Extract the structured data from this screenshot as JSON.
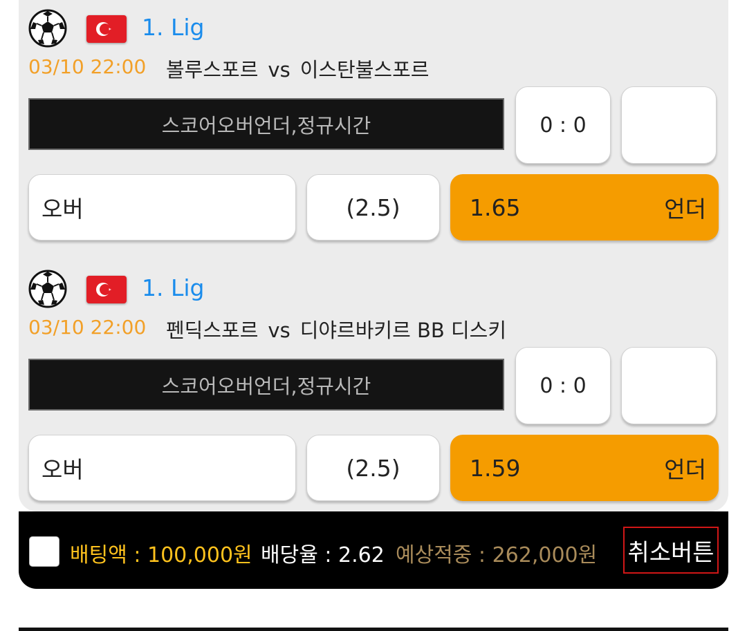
{
  "matches": [
    {
      "sport_icon": "soccer-ball-icon",
      "flag_icon": "turkey-flag-icon",
      "league": "1. Lig",
      "time": "03/10 22:00",
      "home": "볼루스포르",
      "vs": "vs",
      "away": "이스탄불스포르",
      "market": "스코어오버언더,정규시간",
      "score": "0 : 0",
      "over_label": "오버",
      "line": "(2.5)",
      "odds": "1.65",
      "under_label": "언더"
    },
    {
      "sport_icon": "soccer-ball-icon",
      "flag_icon": "turkey-flag-icon",
      "league": "1. Lig",
      "time": "03/10 22:00",
      "home": "펜딕스포르",
      "vs": "vs",
      "away": "디야르바키르 BB 디스키",
      "market": "스코어오버언더,정규시간",
      "score": "0 : 0",
      "over_label": "오버",
      "line": "(2.5)",
      "odds": "1.59",
      "under_label": "언더"
    }
  ],
  "slip": {
    "stake": "배팅액 : 100,000원",
    "odds": "배당율 : 2.62",
    "expected": "예상적중 : 262,000원",
    "cancel": "취소버튼",
    "checked": false
  },
  "colors": {
    "accent_orange": "#f59c00",
    "league_blue": "#1a8cec",
    "time_orange": "#f2a028",
    "stake_yellow": "#ffc21d",
    "expected_gold": "#a98b5a",
    "cancel_border": "#d11717"
  }
}
